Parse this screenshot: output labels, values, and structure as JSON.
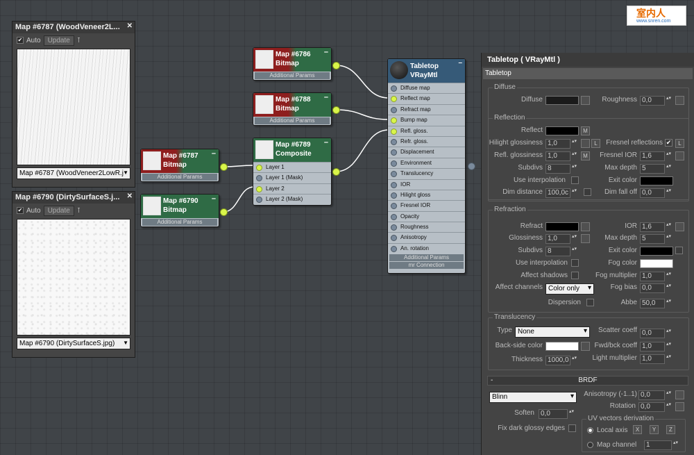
{
  "logo": {
    "main": "室内人",
    "sub": "www.snren.com"
  },
  "preview_wood": {
    "title": "Map #6787 (WoodVeneer2L...",
    "auto": "Auto",
    "update": "Update",
    "map_select": "Map #6787 (WoodVeneer2LowR.j"
  },
  "preview_dirt": {
    "title": "Map #6790 (DirtySurfaceS.j...",
    "auto": "Auto",
    "update": "Update",
    "map_select": "Map #6790 (DirtySurfaceS.jpg)"
  },
  "nodes": {
    "n6786": {
      "name": "Map #6786",
      "type": "Bitmap",
      "extra": "Additional Params"
    },
    "n6788": {
      "name": "Map #6788",
      "type": "Bitmap",
      "extra": "Additional Params"
    },
    "n6787": {
      "name": "Map #6787",
      "type": "Bitmap",
      "extra": "Additional Params"
    },
    "n6790": {
      "name": "Map #6790",
      "type": "Bitmap",
      "extra": "Additional Params"
    },
    "n6789": {
      "name": "Map #6789",
      "type": "Composite",
      "slots": [
        "Layer 1",
        "Layer 1 (Mask)",
        "Layer 2",
        "Layer 2 (Mask)"
      ]
    },
    "vray": {
      "name": "Tabletop",
      "type": "VRayMtl",
      "slots": [
        "Diffuse map",
        "Reflect map",
        "Refract map",
        "Bump map",
        "Refl. gloss.",
        "Refr. gloss.",
        "Displacement",
        "Environment",
        "Translucency",
        "IOR",
        "Hilight gloss",
        "Fresnel IOR",
        "Opacity",
        "Roughness",
        "Anisotropy",
        "An. rotation"
      ],
      "extra1": "Additional Params",
      "extra2": "mr Connection"
    }
  },
  "panel": {
    "title": "Tabletop  ( VRayMtl )",
    "name": "Tabletop",
    "diffuse": {
      "group": "Diffuse",
      "diffuse": "Diffuse",
      "roughness": "Roughness",
      "roughness_val": "0,0"
    },
    "reflection": {
      "group": "Reflection",
      "reflect": "Reflect",
      "m": "M",
      "hilight": "Hilight glossiness",
      "hilight_val": "1,0",
      "l": "L",
      "fresnel": "Fresnel reflections",
      "refl_gloss": "Refl. glossiness",
      "refl_gloss_val": "1,0",
      "fresnel_ior": "Fresnel IOR",
      "fresnel_ior_val": "1,6",
      "subdivs": "Subdivs",
      "subdivs_val": "8",
      "max_depth": "Max depth",
      "max_depth_val": "5",
      "use_interp": "Use interpolation",
      "exit_color": "Exit color",
      "dim_distance": "Dim distance",
      "dim_distance_val": "100,0c",
      "dim_falloff": "Dim fall off",
      "dim_falloff_val": "0,0"
    },
    "refraction": {
      "group": "Refraction",
      "refract": "Refract",
      "ior": "IOR",
      "ior_val": "1,6",
      "glossiness": "Glossiness",
      "glossiness_val": "1,0",
      "max_depth": "Max depth",
      "max_depth_val": "5",
      "subdivs": "Subdivs",
      "subdivs_val": "8",
      "exit_color": "Exit color",
      "use_interp": "Use interpolation",
      "fog_color": "Fog color",
      "affect_shadows": "Affect shadows",
      "fog_mult": "Fog multiplier",
      "fog_mult_val": "1,0",
      "affect_channels": "Affect channels",
      "channels_val": "Color only",
      "fog_bias": "Fog bias",
      "fog_bias_val": "0,0",
      "dispersion": "Dispersion",
      "abbe": "Abbe",
      "abbe_val": "50,0"
    },
    "translucency": {
      "group": "Translucency",
      "type": "Type",
      "type_val": "None",
      "scatter": "Scatter coeff",
      "scatter_val": "0,0",
      "backside": "Back-side color",
      "fwd": "Fwd/bck coeff",
      "fwd_val": "1,0",
      "thickness": "Thickness",
      "thickness_val": "1000,0",
      "light_mult": "Light multiplier",
      "light_mult_val": "1,0"
    },
    "brdf": {
      "rollout": "BRDF",
      "minus": "-",
      "type_val": "Blinn",
      "aniso": "Anisotropy (-1..1)",
      "aniso_val": "0,0",
      "rotation": "Rotation",
      "rotation_val": "0,0",
      "soften": "Soften",
      "soften_val": "0,0",
      "fix_dark": "Fix dark glossy edges",
      "uv_group": "UV vectors derivation",
      "local_axis": "Local axis",
      "x": "X",
      "y": "Y",
      "z": "Z",
      "map_channel": "Map channel",
      "map_channel_val": "1"
    }
  },
  "colors": {
    "diffuse": "#1b1b1b",
    "reflect": "#000000",
    "refract": "#000000",
    "exit": "#000000",
    "fog": "#ffffff",
    "backside": "#ffffff",
    "bitmap_node": "#2f6b45",
    "vray_node": "#365a78",
    "wire": "#ffffff",
    "socket": "#d9f54a"
  }
}
